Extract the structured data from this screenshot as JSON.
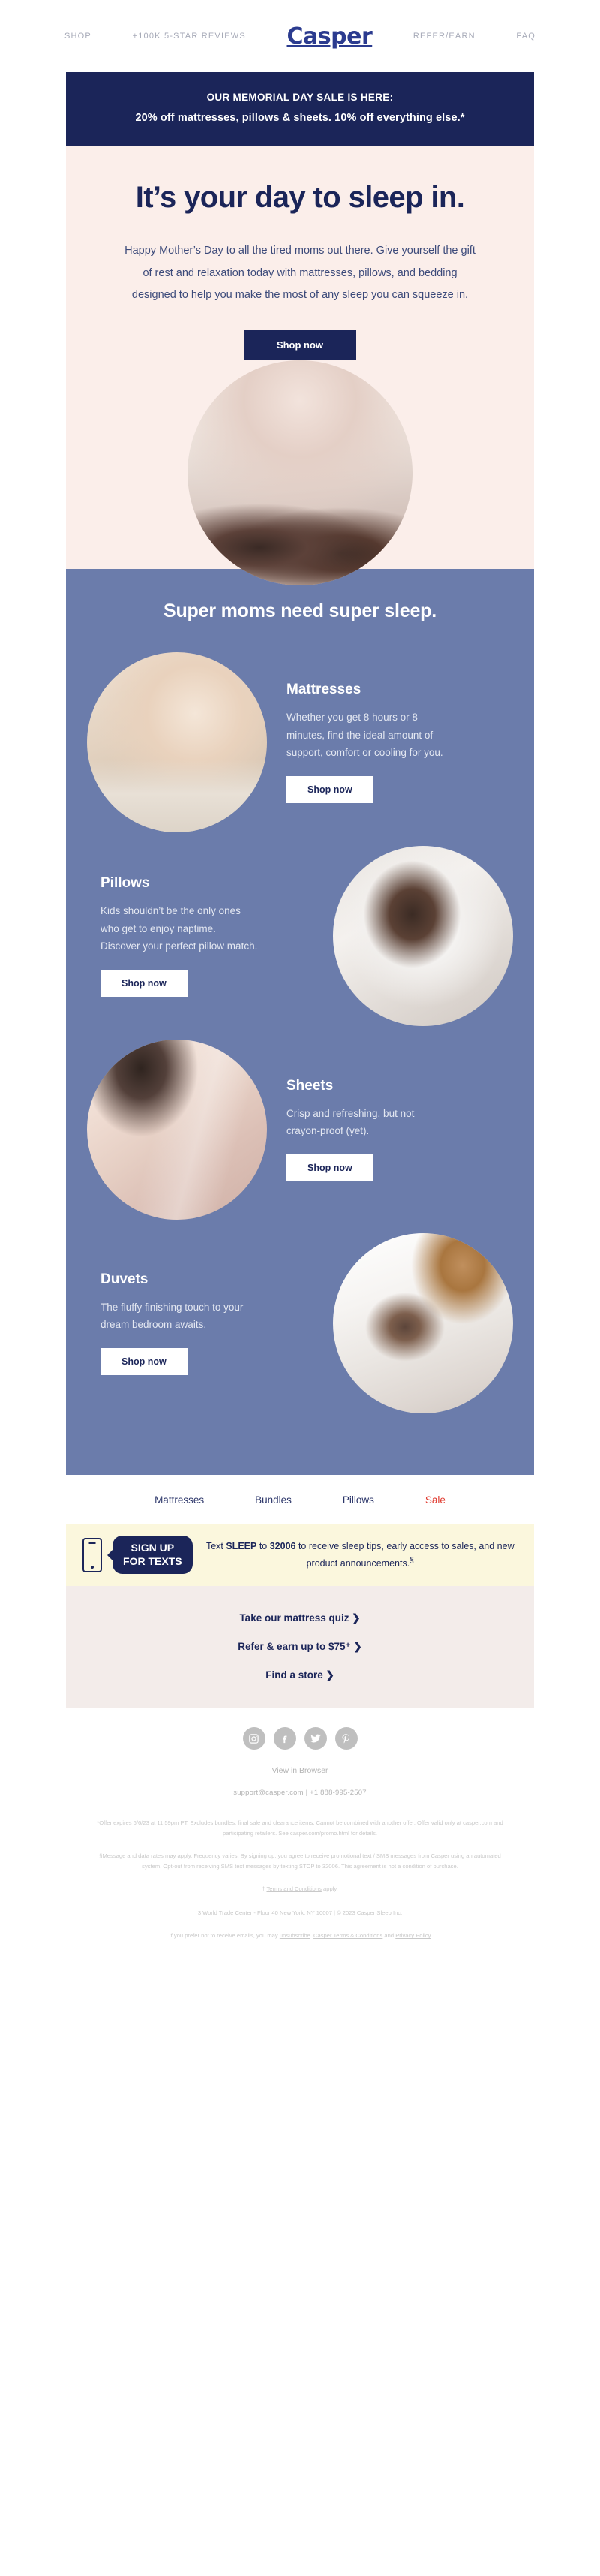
{
  "header": {
    "nav_left": [
      {
        "label": "SHOP",
        "name": "nav-shop"
      },
      {
        "label": "+100K 5-STAR REVIEWS",
        "name": "nav-reviews"
      }
    ],
    "brand": "Casper",
    "nav_right": [
      {
        "label": "REFER/EARN",
        "name": "nav-refer-earn"
      },
      {
        "label": "FAQ",
        "name": "nav-faq"
      }
    ]
  },
  "announcement": {
    "line1": "OUR MEMORIAL DAY SALE IS HERE:",
    "line2": "20% off mattresses, pillows & sheets. 10% off everything else.*"
  },
  "hero": {
    "headline": "It’s your day to sleep in.",
    "body": "Happy Mother’s Day to all the tired moms out there. Give yourself the gift of rest and relaxation today with mattresses, pillows, and bedding designed to help you make the most of any sleep you can squeeze in.",
    "cta": "Shop now",
    "image_alt": "couple-sleeping-in-bed-photo"
  },
  "products": {
    "heading": "Super moms need super sleep.",
    "items": [
      {
        "title": "Mattresses",
        "body": "Whether you get 8 hours or 8 minutes, find the ideal amount of support, comfort or cooling for you.",
        "cta": "Shop now",
        "image_alt": "woman-stretching-on-mattress-photo",
        "image_side": "left"
      },
      {
        "title": "Pillows",
        "body": "Kids shouldn’t be the only ones who get to enjoy naptime. Discover your perfect pillow match.",
        "cta": "Shop now",
        "image_alt": "woman-hugging-pillow-photo",
        "image_side": "right"
      },
      {
        "title": "Sheets",
        "body": "Crisp and refreshing, but not crayon-proof (yet).",
        "cta": "Shop now",
        "image_alt": "person-making-bed-with-sheets-photo",
        "image_side": "left"
      },
      {
        "title": "Duvets",
        "body": "The fluffy finishing touch to your dream bedroom awaits.",
        "cta": "Shop now",
        "image_alt": "person-smoothing-white-duvet-photo",
        "image_side": "right"
      }
    ]
  },
  "footer_nav": [
    {
      "label": "Mattresses",
      "name": "footer-nav-mattresses",
      "highlight": false
    },
    {
      "label": "Bundles",
      "name": "footer-nav-bundles",
      "highlight": false
    },
    {
      "label": "Pillows",
      "name": "footer-nav-pillows",
      "highlight": false
    },
    {
      "label": "Sale",
      "name": "footer-nav-sale",
      "highlight": true
    }
  ],
  "sms": {
    "bubble_line1": "SIGN UP",
    "bubble_line2": "FOR TEXTS",
    "text_before_keyword": "Text ",
    "keyword": "SLEEP",
    "text_between": " to ",
    "shortcode": "32006",
    "text_after": " to receive sleep tips, early access to sales, and new product announcements.",
    "footnote_marker": "§"
  },
  "cta_links": [
    {
      "label": "Take our mattress quiz ❯",
      "name": "cta-mattress-quiz"
    },
    {
      "label": "Refer & earn up to $75⁺ ❯",
      "name": "cta-refer-earn"
    },
    {
      "label": "Find a store ❯",
      "name": "cta-find-store"
    }
  ],
  "social": [
    {
      "name": "instagram-icon",
      "glyph": "▣"
    },
    {
      "name": "facebook-icon",
      "glyph": "f"
    },
    {
      "name": "twitter-icon",
      "glyph": "ᴠ"
    },
    {
      "name": "pinterest-icon",
      "glyph": "р"
    }
  ],
  "footer": {
    "view_in_browser": "View in Browser",
    "contact": "support@casper.com | +1 888-995-2507",
    "legal_offer": "*Offer expires 6/6/23 at 11:59pm PT. Excludes bundles, final sale and clearance items. Cannot be combined with another offer. Offer valid only at casper.com and participating retailers. See casper.com/promo.html for details.",
    "legal_sms": "§Message and data rates may apply. Frequency varies. By signing up, you agree to receive promotional text / SMS messages from Casper using an automated system. Opt-out from receiving SMS text messages by texting STOP to 32006. This agreement is not a condition of purchase.",
    "legal_terms_prefix": "† ",
    "legal_terms_link": "Terms and Conditions",
    "legal_terms_suffix": " apply.",
    "address": "3 World Trade Center - Floor 40 New York, NY 10007 | © 2023 Casper Sleep Inc.",
    "unsub_prefix": "If you prefer not to receive emails, you may ",
    "unsub_link": "unsubscribe",
    "unsub_mid": ". ",
    "terms_link": "Casper Terms & Conditions",
    "unsub_and": " and ",
    "privacy_link": "Privacy Policy"
  },
  "colors": {
    "navy": "#1b2559",
    "brand_blue": "#2b3b8f",
    "hero_pink": "#fbeeea",
    "product_blue": "#6b7cab",
    "sms_cream": "#fbf7dd",
    "cta_pink": "#f3ecea",
    "sale_red": "#e03a2f"
  }
}
